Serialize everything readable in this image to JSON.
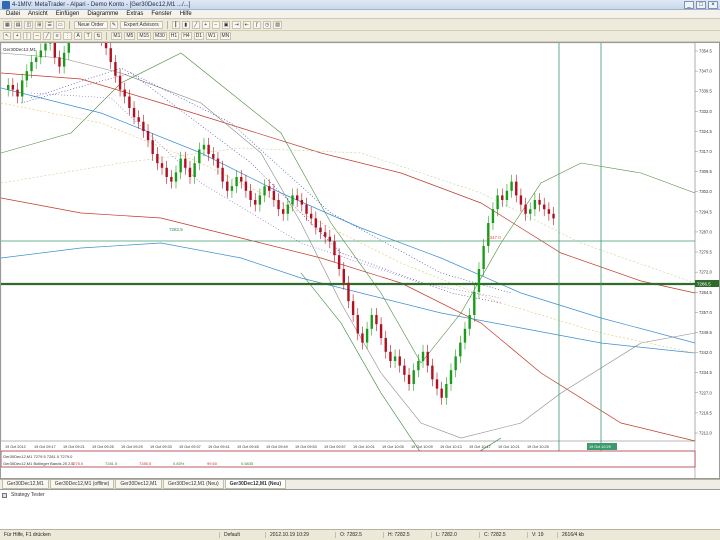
{
  "window": {
    "title": "4-1MIV: MetaTrader - Alpari - Demo Konto - [Ger30Dec12,M1 .../...]",
    "controls": [
      "_",
      "□",
      "×"
    ]
  },
  "menu": [
    "Datei",
    "Ansicht",
    "Einfügen",
    "Diagramme",
    "Extras",
    "Fenster",
    "Hilfe"
  ],
  "toolbar1": {
    "new_order": "Neue Order",
    "expert_advisors": "Expert Advisors",
    "periods": [
      "M1",
      "M5",
      "M15",
      "M30",
      "H1",
      "H4",
      "D1",
      "W1",
      "MN"
    ]
  },
  "chart": {
    "symbol_label": "Ger30Dec12,M1",
    "level_labels": [
      {
        "text": "7347.0",
        "color": "#d9534f"
      },
      {
        "text": "7282.5",
        "color": "#2e8b57"
      }
    ],
    "price_scale": [
      "7354.5",
      "7347.0",
      "7339.5",
      "7332.0",
      "7324.5",
      "7317.0",
      "7309.5",
      "7302.0",
      "7294.5",
      "7287.0",
      "7279.5",
      "7272.0",
      "7264.5",
      "7257.0",
      "7249.5",
      "7242.0",
      "7234.5",
      "7227.0",
      "7219.5",
      "7212.0"
    ],
    "current_price": "7286.5",
    "time_labels": [
      "19 Oct 2012",
      "19 Oct 09:17",
      "19 Oct 09:21",
      "19 Oct 09:25",
      "19 Oct 09:29",
      "19 Oct 09:33",
      "19 Oct 09:37",
      "19 Oct 09:41",
      "19 Oct 09:45",
      "19 Oct 09:49",
      "19 Oct 09:53",
      "19 Oct 09:57",
      "19 Oct 10:01",
      "19 Oct 10:05",
      "19 Oct 10:09",
      "19 Oct 10:13",
      "19 Oct 10:17",
      "19 Oct 10:21",
      "19 Oct 10:25"
    ],
    "highlight_time": "19 Oct 10:29",
    "info_line": "Ger30Dec12,M1 7279.5 7281.0 7279.0",
    "indicator_line": "Ger30Dec12,M1  Bollinger Bands  20  2.0",
    "indicator_values": [
      "7275.0",
      "7281.5",
      "7285.5",
      "0.83%",
      "99.60",
      "0.5835"
    ]
  },
  "tabs": [
    "Ger30Dec12,M1",
    "Ger30Dec12,M1 (offline)",
    "Ger30Dec12,M1",
    "Ger30Dec12,M1 (Neu)",
    "Ger30Dec12,M1 (Neu)"
  ],
  "log": {
    "header": "Strategy Tester"
  },
  "status": {
    "help": "Für Hilfe, F1 drücken",
    "profile": "Default",
    "datetime": "2012.10.19 10:29",
    "open": "O: 7282.5",
    "high": "H: 7282.5",
    "low": "L: 7282.0",
    "close": "C: 7282.5",
    "volume": "V: 19",
    "traffic": "2616/4 kb"
  }
}
